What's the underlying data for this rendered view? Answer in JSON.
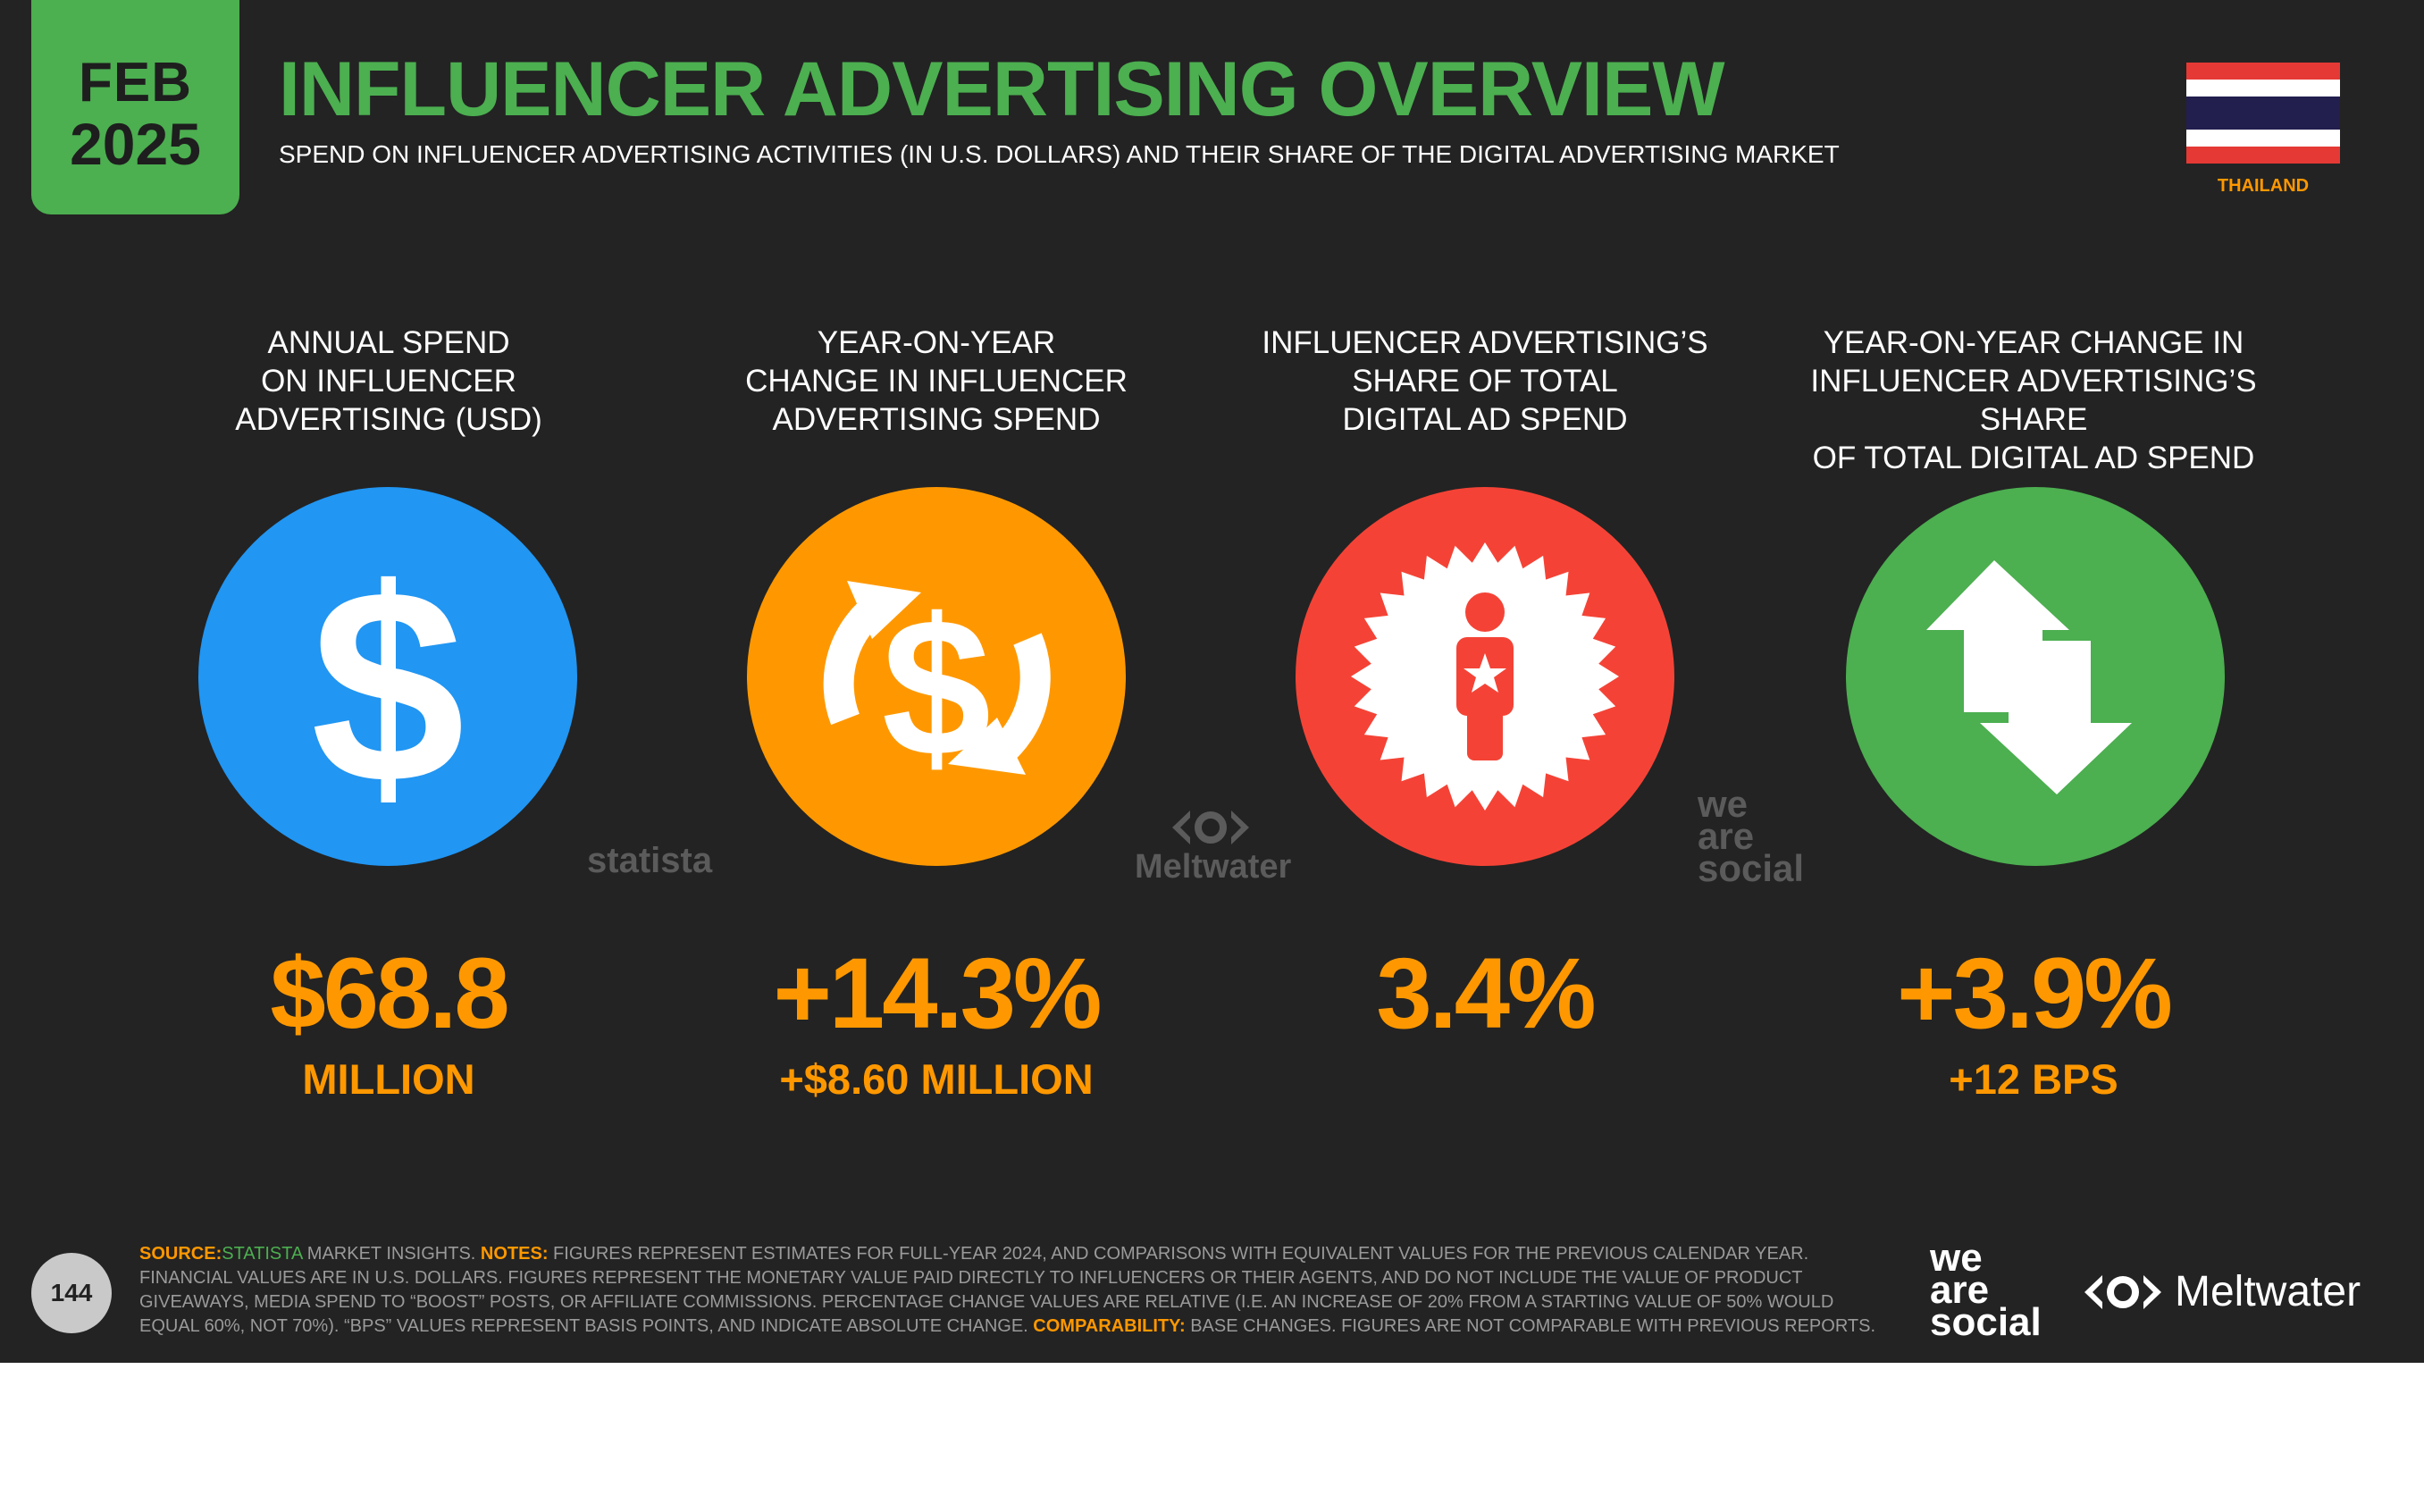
{
  "date_badge": {
    "month": "FEB",
    "year": "2025"
  },
  "title": "INFLUENCER ADVERTISING OVERVIEW",
  "subtitle": "SPEND ON INFLUENCER ADVERTISING ACTIVITIES (IN U.S. DOLLARS) AND THEIR SHARE OF THE DIGITAL ADVERTISING MARKET",
  "country": {
    "name": "THAILAND",
    "flag": "thailand-flag"
  },
  "kpis": [
    {
      "heading": "ANNUAL SPEND\nON INFLUENCER\nADVERTISING (USD)",
      "value": "$68.8",
      "sub": "MILLION",
      "icon": "dollar-icon",
      "color": "#2196f3"
    },
    {
      "heading": "YEAR-ON-YEAR\nCHANGE IN INFLUENCER\nADVERTISING SPEND",
      "value": "+14.3%",
      "sub": "+$8.60 MILLION",
      "icon": "dollar-change-icon",
      "color": "#ff9800"
    },
    {
      "heading": "INFLUENCER ADVERTISING’S\nSHARE OF TOTAL\nDIGITAL AD SPEND",
      "value": "3.4%",
      "sub": "",
      "icon": "influencer-badge-icon",
      "color": "#f44336"
    },
    {
      "heading": "YEAR-ON-YEAR CHANGE IN\nINFLUENCER ADVERTISING’S SHARE\nOF TOTAL DIGITAL AD SPEND",
      "value": "+3.9%",
      "sub": "+12 BPS",
      "icon": "up-down-arrows-icon",
      "color": "#4caf50"
    }
  ],
  "watermarks": {
    "statista": "statista",
    "meltwater": "Meltwater",
    "wearesocial": "we\nare\nsocial"
  },
  "footer": {
    "page_number": "144",
    "source_label": "SOURCE:",
    "source_name": "STATISTA",
    "source_rest": " MARKET INSIGHTS. ",
    "notes_label": "NOTES:",
    "notes_text": " FIGURES REPRESENT ESTIMATES FOR FULL-YEAR 2024, AND COMPARISONS WITH EQUIVALENT VALUES FOR THE PREVIOUS CALENDAR YEAR. FINANCIAL VALUES ARE IN U.S. DOLLARS. FIGURES REPRESENT THE MONETARY VALUE PAID DIRECTLY TO INFLUENCERS OR THEIR AGENTS, AND DO NOT INCLUDE THE VALUE OF PRODUCT GIVEAWAYS, MEDIA SPEND TO “BOOST” POSTS, OR AFFILIATE COMMISSIONS. PERCENTAGE CHANGE VALUES ARE RELATIVE (I.E. AN INCREASE OF 20% FROM A STARTING VALUE OF 50% WOULD EQUAL 60%, NOT 70%). “BPS” VALUES REPRESENT BASIS POINTS, AND INDICATE ABSOLUTE CHANGE. ",
    "comparability_label": "COMPARABILITY:",
    "comparability_text": " BASE CHANGES. FIGURES ARE NOT COMPARABLE WITH PREVIOUS REPORTS.",
    "logo_wearesocial": "we\nare\nsocial",
    "logo_meltwater": "Meltwater"
  }
}
